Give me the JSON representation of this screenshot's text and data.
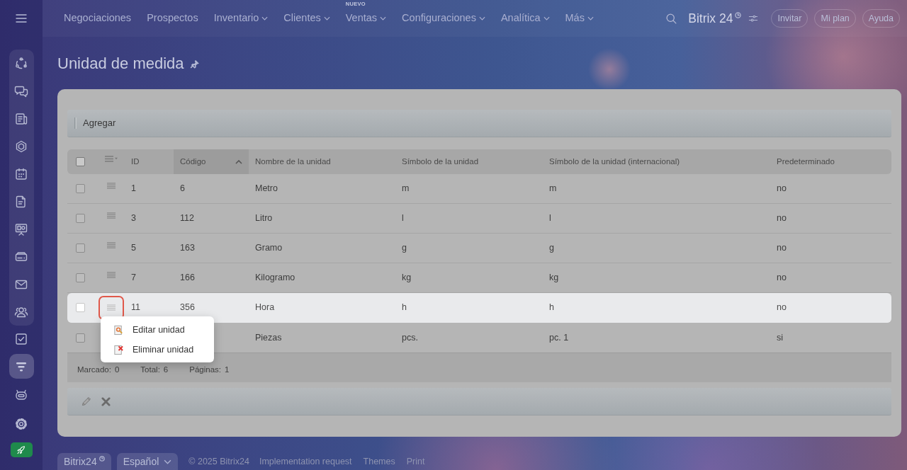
{
  "sidebar": {
    "pinned": [
      {
        "kind": "orbit",
        "selected": false
      },
      {
        "kind": "chat",
        "selected": false
      },
      {
        "kind": "news",
        "selected": false
      },
      {
        "kind": "hexagon",
        "selected": false
      },
      {
        "kind": "calendar",
        "selected": false
      },
      {
        "kind": "document",
        "selected": false
      },
      {
        "kind": "board",
        "selected": false
      },
      {
        "kind": "drive",
        "selected": false
      },
      {
        "kind": "mail",
        "selected": false
      },
      {
        "kind": "people",
        "selected": false
      }
    ],
    "items": [
      {
        "kind": "tasks",
        "selected": false
      },
      {
        "kind": "funnel",
        "selected": true
      },
      {
        "kind": "robot",
        "selected": false
      },
      {
        "kind": "gear",
        "selected": false
      },
      {
        "kind": "rocket",
        "selected": false
      }
    ]
  },
  "nav": {
    "items": [
      {
        "label": "Negociaciones",
        "dropdown": false
      },
      {
        "label": "Prospectos",
        "dropdown": false
      },
      {
        "label": "Inventario",
        "dropdown": true
      },
      {
        "label": "Clientes",
        "dropdown": true
      },
      {
        "label": "Ventas",
        "dropdown": true,
        "badge": "NUEVO"
      },
      {
        "label": "Configuraciones",
        "dropdown": true
      },
      {
        "label": "Analítica",
        "dropdown": true
      },
      {
        "label": "Más",
        "dropdown": true
      }
    ]
  },
  "header": {
    "logo": "Bitrix 24",
    "buttons": [
      "Invitar",
      "Mi plan",
      "Ayuda"
    ]
  },
  "page": {
    "title": "Unidad de medida"
  },
  "toolbar": {
    "buttons": [
      "Agregar"
    ]
  },
  "table": {
    "select_all": {
      "checked": false
    },
    "columns": [
      {
        "label": "ID",
        "sorted": false
      },
      {
        "label": "Código",
        "sorted": true
      },
      {
        "label": "Nombre de la unidad",
        "sorted": false
      },
      {
        "label": "Símbolo de la unidad",
        "sorted": false
      },
      {
        "label": "Símbolo de la unidad (internacional)",
        "sorted": false
      },
      {
        "label": "Predeterminado",
        "sorted": false
      }
    ],
    "rows": [
      {
        "checked": false,
        "highlighted": false,
        "cells": [
          "1",
          "6",
          "Metro",
          "m",
          "m",
          "no"
        ]
      },
      {
        "checked": false,
        "highlighted": false,
        "cells": [
          "3",
          "112",
          "Litro",
          "l",
          "l",
          "no"
        ]
      },
      {
        "checked": false,
        "highlighted": false,
        "cells": [
          "5",
          "163",
          "Gramo",
          "g",
          "g",
          "no"
        ]
      },
      {
        "checked": false,
        "highlighted": false,
        "cells": [
          "7",
          "166",
          "Kilogramo",
          "kg",
          "kg",
          "no"
        ]
      },
      {
        "checked": false,
        "highlighted": true,
        "cells": [
          "11",
          "356",
          "Hora",
          "h",
          "h",
          "no"
        ]
      },
      {
        "checked": false,
        "highlighted": false,
        "cells": [
          null,
          null,
          "Piezas",
          "pcs.",
          "pc. 1",
          "si"
        ]
      }
    ],
    "summary": [
      {
        "label": "Marcado:",
        "value": "0"
      },
      {
        "label": "Total:",
        "value": "6"
      },
      {
        "label": "Páginas:",
        "value": "1"
      }
    ]
  },
  "context_menu": {
    "items": [
      {
        "kind": "edit",
        "label": "Editar unidad"
      },
      {
        "kind": "delete",
        "label": "Eliminar unidad"
      }
    ]
  },
  "action_bar": {
    "buttons": [
      {
        "kind": "edit"
      },
      {
        "kind": "delete"
      }
    ]
  },
  "footer": {
    "brand": "Bitrix24",
    "language": "Español",
    "copyright": "© 2025 Bitrix24",
    "links": [
      "Implementation request",
      "Themes",
      "Print"
    ]
  }
}
